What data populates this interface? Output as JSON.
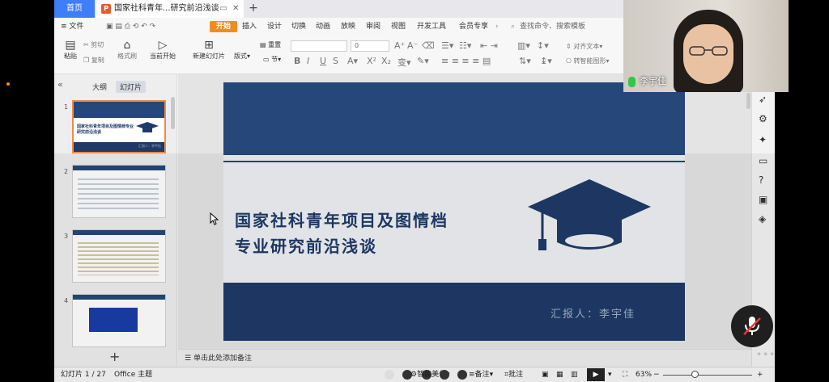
{
  "titlebar": {
    "home_tab": "首页",
    "doc_tab": "国家社科青年...研究前沿浅谈",
    "ppt_icon": "P",
    "new_tab": "+"
  },
  "menu": {
    "file": "≡ 文件",
    "start": "开始",
    "insert": "插入",
    "design": "设计",
    "transition": "切换",
    "animation": "动画",
    "slideshow": "放映",
    "review": "审阅",
    "view": "视图",
    "devtools": "开发工具",
    "member": "会员专享",
    "search": "查找命令、搜索模板"
  },
  "toolbar": {
    "paste": "粘贴",
    "cut": "剪切",
    "copy": "复制",
    "format_painter": "格式刷",
    "from_current": "当前开始",
    "new_slide": "新建幻灯片",
    "layout": "版式",
    "section": "节",
    "reset": "重置",
    "font_size": "0",
    "align_text": "对齐文本",
    "to_smartart": "转智能图形"
  },
  "left_panel": {
    "tab_outline": "大纲",
    "tab_slides": "幻灯片",
    "slide_numbers": [
      "1",
      "2",
      "3",
      "4"
    ],
    "add": "+",
    "thumb1_title": "国家社科青年项目及图情档专业研究前沿浅谈",
    "thumb1_reporter": "汇报人：李宇佳"
  },
  "slide": {
    "title_line1": "国家社科青年项目及图情档",
    "title_line2": "专业研究前沿浅谈",
    "reporter": "汇报人：李宇佳"
  },
  "notes": {
    "placeholder": "单击此处添加备注"
  },
  "statusbar": {
    "slide_counter": "幻灯片 1 / 27",
    "theme": "Office 主题",
    "smart": "智能美化",
    "notes": "备注",
    "comment": "批注",
    "zoom": "63%",
    "zoom_minus": "−",
    "zoom_plus": "+"
  },
  "webcam": {
    "participant_name": "李宇佳"
  },
  "colors": {
    "accent": "#f18c1e",
    "slide_navy": "#1f3a68",
    "home_blue": "#3f7ef6"
  }
}
